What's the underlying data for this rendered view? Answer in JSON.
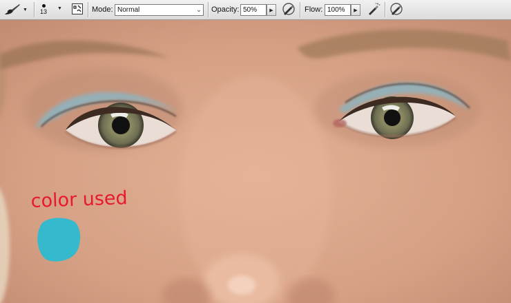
{
  "toolbar": {
    "brush_size": "13",
    "mode_label": "Mode:",
    "mode_value": "Normal",
    "opacity_label": "Opacity:",
    "opacity_value": "50%",
    "flow_label": "Flow:",
    "flow_value": "100%",
    "icons": [
      "brush-tool-icon",
      "brush-preset-icon",
      "brush-panel-icon",
      "pressure-opacity-icon",
      "airbrush-icon",
      "pressure-size-icon"
    ]
  },
  "canvas": {
    "annotation_text": "color used",
    "annotation_color": "#e8192c",
    "swatch_color": "#35b9cc"
  }
}
